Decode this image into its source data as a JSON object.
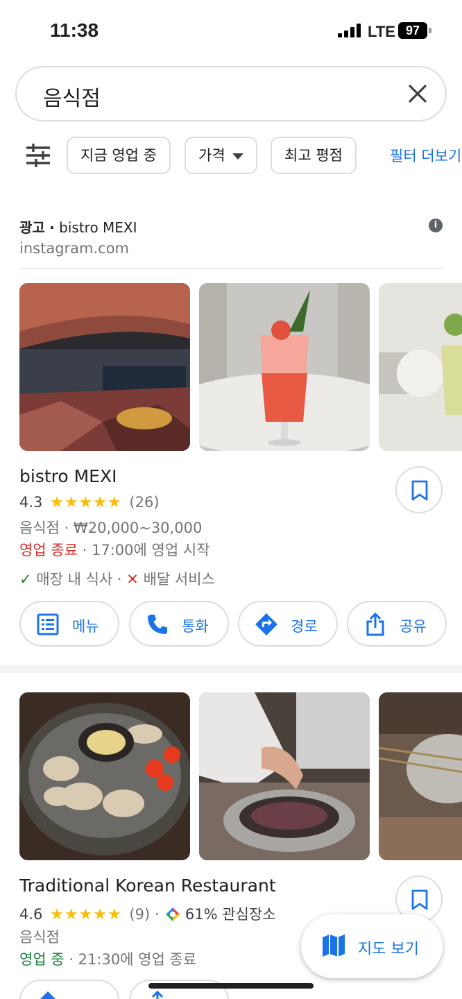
{
  "status_bar": {
    "time": "11:38",
    "network": "LTE",
    "battery": "97"
  },
  "search": {
    "query": "음식점"
  },
  "filters": {
    "chips": [
      "지금 영업 중",
      "가격",
      "최고 평점"
    ],
    "more": "필터 더보기"
  },
  "ad": {
    "label": "광고",
    "sep": "·",
    "advertiser": "bistro MEXI",
    "domain": "instagram.com",
    "info_glyph": "i"
  },
  "results": [
    {
      "name": "bistro MEXI",
      "rating": "4.3",
      "stars": "★★★★★",
      "reviews": "(26)",
      "category_line": "음식점 · ₩20,000~30,000",
      "status": "영업 종료",
      "status_detail": " · 17:00에 영업 시작",
      "dine_in": "매장 내 식사 ·",
      "delivery": "배달 서비스",
      "actions": [
        "메뉴",
        "통화",
        "경로",
        "공유"
      ]
    },
    {
      "name": "Traditional Korean Restaurant",
      "rating": "4.6",
      "stars": "★★★★★",
      "reviews": "(9) ·",
      "interest": "61% 관심장소",
      "category_line": "음식점",
      "status": "영업 중",
      "status_detail": " · 21:30에 영업 종료"
    }
  ],
  "map_button": {
    "label": "지도 보기"
  },
  "colors": {
    "accent": "#1a73e8",
    "closed": "#d93025",
    "open": "#188038",
    "star": "#fbbc04"
  },
  "icons": [
    "signal-icon",
    "close-icon",
    "tune-icon",
    "chevron-down-icon",
    "info-icon",
    "bookmark-icon",
    "menu-list-icon",
    "phone-icon",
    "directions-icon",
    "share-icon",
    "check-icon",
    "cross-icon",
    "map-icon"
  ]
}
